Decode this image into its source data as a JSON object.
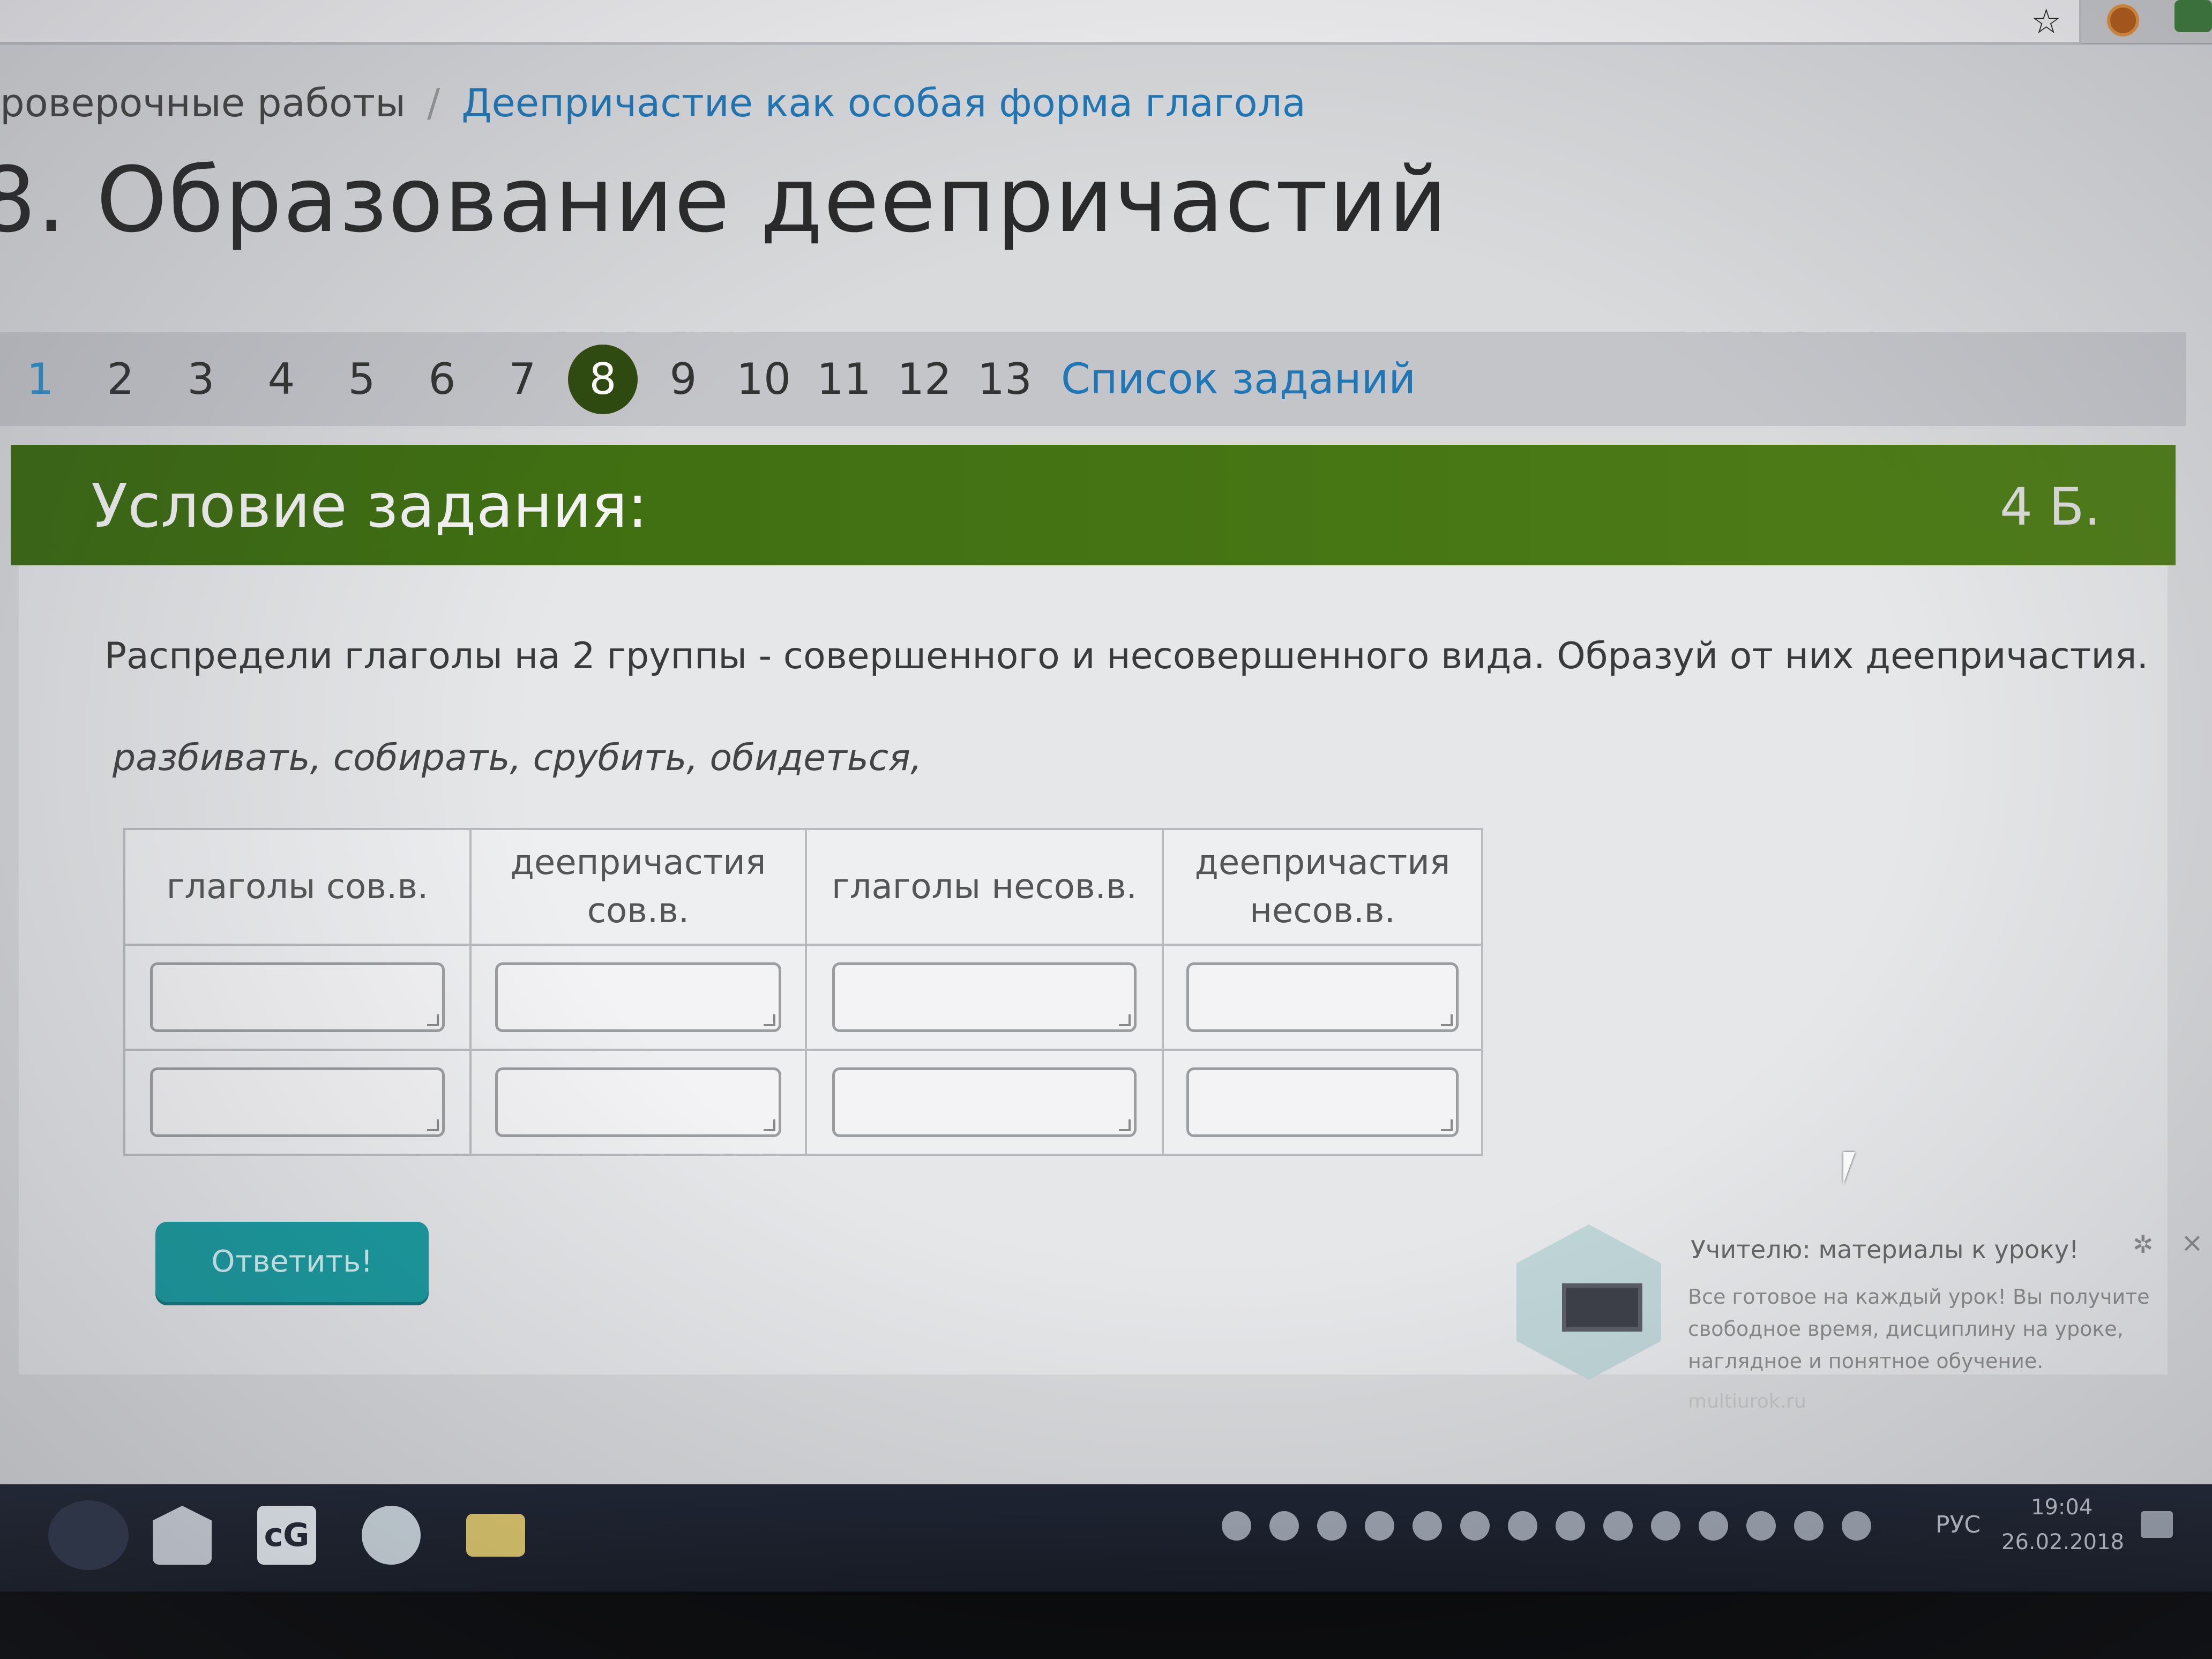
{
  "breadcrumb": {
    "parent": "роверочные работы",
    "separator": "/",
    "current": "Деепричастие как особая форма глагола"
  },
  "page": {
    "title": "8. Образование деепричастий"
  },
  "task_nav": {
    "numbers": [
      "1",
      "2",
      "3",
      "4",
      "5",
      "6",
      "7",
      "8",
      "9",
      "10",
      "11",
      "12",
      "13"
    ],
    "current": "8",
    "list_link": "Список заданий"
  },
  "condition": {
    "title": "Условие задания:",
    "points": "4 Б.",
    "instruction": "Распредели глаголы на 2 группы - совершенного и несовершенного вида. Образуй от них деепричастия.",
    "verbs": "разбивать, собирать, срубить, обидеться,"
  },
  "table": {
    "headers": [
      "глаголы сов.в.",
      "деепричастия сов.в.",
      "глаголы несов.в.",
      "деепричастия несов.в."
    ],
    "rows": [
      [
        "",
        "",
        "",
        ""
      ],
      [
        "",
        "",
        "",
        ""
      ]
    ]
  },
  "submit_label": "Ответить!",
  "ad": {
    "title": "Учителю: материалы к уроку!",
    "text": "Все готовое на каждый урок! Вы получите свободное время, дисциплину на уроке, наглядное и понятное обучение.",
    "source": "multiurok.ru"
  },
  "taskbar": {
    "language": "РУС",
    "time": "19:04",
    "date": "26.02.2018"
  },
  "colors": {
    "accent_green": "#3f6c12",
    "link_blue": "#1e78b8",
    "button_teal": "#179a9e"
  }
}
